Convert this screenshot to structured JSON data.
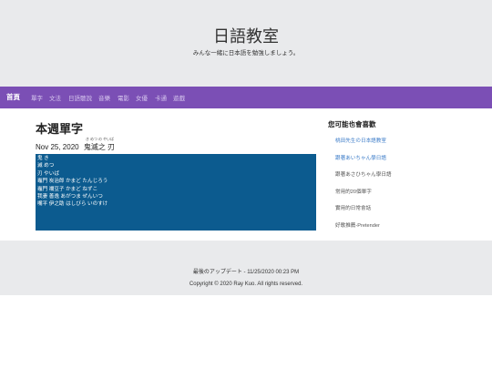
{
  "header": {
    "title": "日語教室",
    "subtitle": "みんな一緒に日本語を勉強しましょう。"
  },
  "nav": {
    "items": [
      "首頁",
      "單字",
      "文法",
      "日語聽說",
      "音樂",
      "電影",
      "女優",
      "卡通",
      "遊戲"
    ]
  },
  "post": {
    "title": "本週單字",
    "date": "Nov 25, 2020",
    "word": "鬼滅之 刃",
    "ruby": "き めつ の やいば",
    "vocab": [
      "鬼 き",
      "滅 めつ",
      "刃 やいば",
      "竈門 炭治郎 かまど たんじろう",
      "竈門 禰豆子 かまど ねずこ",
      "我妻 善逸 あがつま ぜんいつ",
      "嘴平 伊之助 はしびら いのすけ"
    ]
  },
  "aside": {
    "title": "您可能也會喜歡",
    "links": [
      "桃田先生の日本語教室",
      "跟著あいちゃん學日語",
      "跟著あさひちゃん學日語",
      "常用的20個單字",
      "實用的日常會話",
      "好歌推薦-Pretender"
    ]
  },
  "footer": {
    "updated": "最後のアップデート - 11/25/2020 00:23 PM",
    "copyright": "Copyright © 2020 Ray Kuo. All rights reserved."
  },
  "colors": {
    "nav_bg": "#7b4fb5",
    "vocab_bg": "#0c5b8f",
    "link": "#3a7bc8",
    "header_bg": "#e9eaec"
  }
}
